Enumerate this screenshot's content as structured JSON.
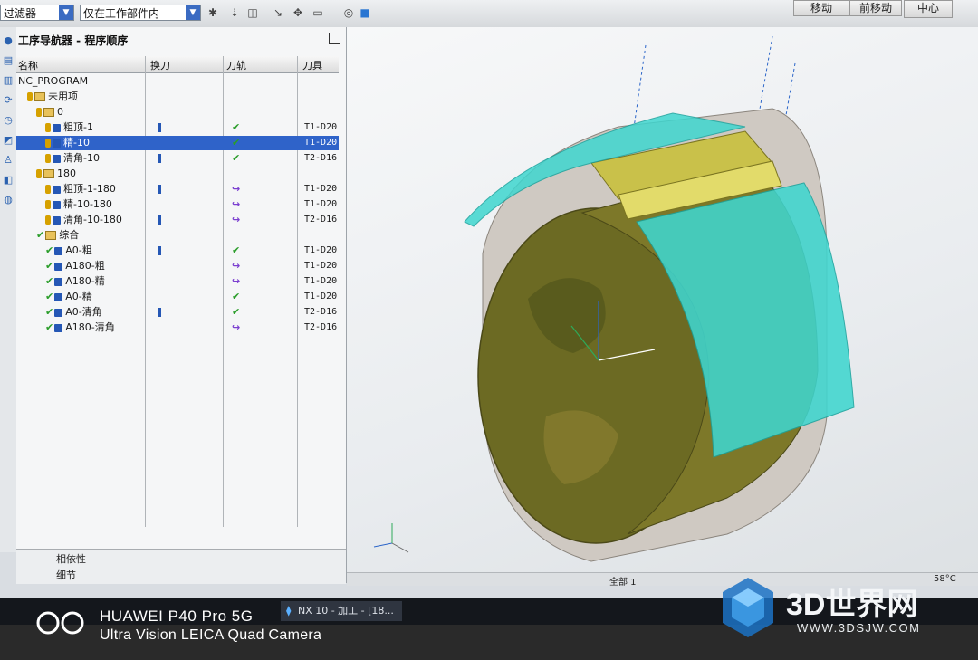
{
  "toolbar": {
    "filter_combo": "过滤器",
    "scope_combo": "仅在工作部件内",
    "right_buttons": [
      "移动",
      "前移动",
      "中心"
    ]
  },
  "navigator": {
    "title": "工序导航器 - 程序顺序",
    "columns": [
      "名称",
      "换刀",
      "刀轨",
      "刀具"
    ],
    "rows": [
      {
        "name": "NC_PROGRAM",
        "indent": 0,
        "type": "root"
      },
      {
        "name": "未用项",
        "indent": 1,
        "type": "folder"
      },
      {
        "name": "0",
        "indent": 2,
        "type": "folder"
      },
      {
        "name": "粗顶-1",
        "indent": 3,
        "type": "op",
        "tc": true,
        "path": "ok",
        "tool": "T1-D20"
      },
      {
        "name": "精-10",
        "indent": 3,
        "type": "op",
        "tc": false,
        "path": "ok",
        "tool": "T1-D20",
        "selected": true
      },
      {
        "name": "清角-10",
        "indent": 3,
        "type": "op",
        "tc": true,
        "path": "ok",
        "tool": "T2-D16"
      },
      {
        "name": "180",
        "indent": 2,
        "type": "folder"
      },
      {
        "name": "粗顶-1-180",
        "indent": 3,
        "type": "op",
        "tc": true,
        "path": "regen",
        "tool": "T1-D20"
      },
      {
        "name": "精-10-180",
        "indent": 3,
        "type": "op",
        "tc": false,
        "path": "regen",
        "tool": "T1-D20"
      },
      {
        "name": "清角-10-180",
        "indent": 3,
        "type": "op",
        "tc": true,
        "path": "regen",
        "tool": "T2-D16"
      },
      {
        "name": "综合",
        "indent": 2,
        "type": "folder_ok"
      },
      {
        "name": "A0-粗",
        "indent": 3,
        "type": "op_ok",
        "tc": true,
        "path": "ok",
        "tool": "T1-D20"
      },
      {
        "name": "A180-粗",
        "indent": 3,
        "type": "op_ok",
        "tc": false,
        "path": "regen",
        "tool": "T1-D20"
      },
      {
        "name": "A180-精",
        "indent": 3,
        "type": "op_ok",
        "tc": false,
        "path": "regen",
        "tool": "T1-D20"
      },
      {
        "name": "A0-精",
        "indent": 3,
        "type": "op_ok",
        "tc": false,
        "path": "ok",
        "tool": "T1-D20"
      },
      {
        "name": "A0-清角",
        "indent": 3,
        "type": "op_ok",
        "tc": true,
        "path": "ok",
        "tool": "T2-D16"
      },
      {
        "name": "A180-清角",
        "indent": 3,
        "type": "op_ok",
        "tc": false,
        "path": "regen",
        "tool": "T2-D16"
      }
    ],
    "bottom_labels": [
      "相依性",
      "细节"
    ]
  },
  "statusbar": {
    "selection": "全部 1",
    "temp": "58°C"
  },
  "taskbar": {
    "app_label": "NX 10 - 加工 - [18..."
  },
  "watermark": {
    "camera_line1": "HUAWEI P40 Pro 5G",
    "camera_line2": "Ultra Vision LEICA Quad Camera",
    "site_title": "3D世界网",
    "site_url": "WWW.3DSJW.COM"
  },
  "colors": {
    "selection": "#2f63c9",
    "cyan_surface": "#35d6cf",
    "olive_part": "#6f6a1e"
  }
}
